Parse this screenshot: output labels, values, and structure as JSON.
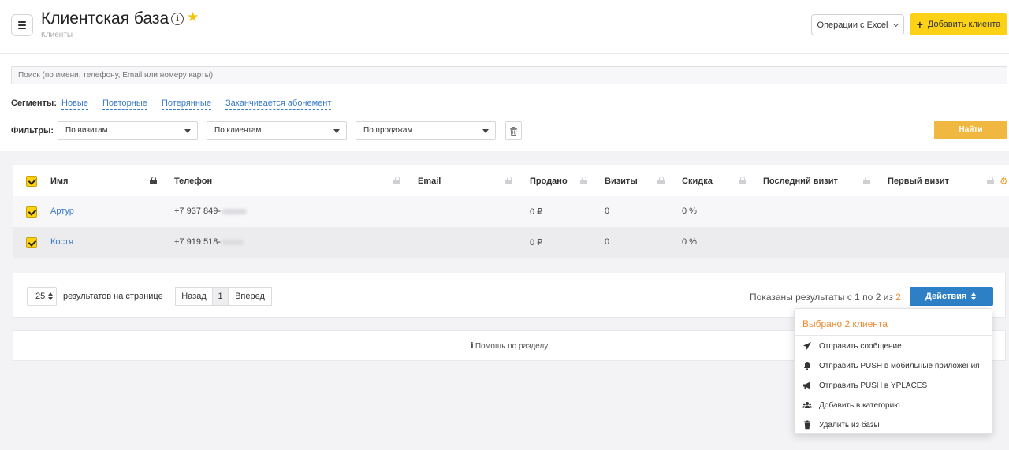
{
  "header": {
    "title": "Клиентская база",
    "breadcrumb": "Клиенты",
    "excel_label": "Операции с Excel",
    "add_client_label": "Добавить клиента",
    "add_icon": "+"
  },
  "search": {
    "placeholder": "Поиск (по имени, телефону, Email или номеру карты)"
  },
  "segments": {
    "label": "Сегменты:",
    "items": [
      "Новые",
      "Повторные",
      "Потерянные",
      "Заканчивается абонемент"
    ]
  },
  "filters": {
    "label": "Фильтры:",
    "selects": [
      "По визитам",
      "По клиентам",
      "По продажам"
    ],
    "find_label": "Найти"
  },
  "table": {
    "columns": [
      "Имя",
      "Телефон",
      "Email",
      "Продано",
      "Визиты",
      "Скидка",
      "Последний визит",
      "Первый визит"
    ],
    "rows": [
      {
        "name": "Артур",
        "phone": "+7 937 849-",
        "email": "",
        "sold": "0 ₽",
        "visits": "0",
        "discount": "0 %",
        "last_visit": "",
        "first_visit": ""
      },
      {
        "name": "Костя",
        "phone": "+7 919 518-",
        "email": "",
        "sold": "0 ₽",
        "visits": "0",
        "discount": "0 %",
        "last_visit": "",
        "first_visit": ""
      }
    ]
  },
  "pagination": {
    "per_page": "25",
    "per_page_label": "результатов на странице",
    "prev": "Назад",
    "page": "1",
    "next": "Вперед",
    "shown_text": "Показаны результаты с 1 по 2 из",
    "total": "2",
    "actions_label": "Действия"
  },
  "help": {
    "label": "Помощь по разделу"
  },
  "dropdown": {
    "header": "Выбрано 2 клиента",
    "items": [
      {
        "label": "Отправить сообщение",
        "icon": "paper-plane-icon"
      },
      {
        "label": "Отправить PUSH в мобильные приложения",
        "icon": "bell-icon"
      },
      {
        "label": "Отправить PUSH в YPLACES",
        "icon": "megaphone-icon"
      },
      {
        "label": "Добавить в категорию",
        "icon": "users-icon"
      },
      {
        "label": "Удалить из базы",
        "icon": "trash-icon"
      }
    ]
  },
  "colors": {
    "accent_yellow": "#fcd116",
    "find_button": "#f0b840",
    "link_blue": "#3a7bc8",
    "actions_blue": "#2d7fc6",
    "highlight_orange": "#f08a30"
  }
}
